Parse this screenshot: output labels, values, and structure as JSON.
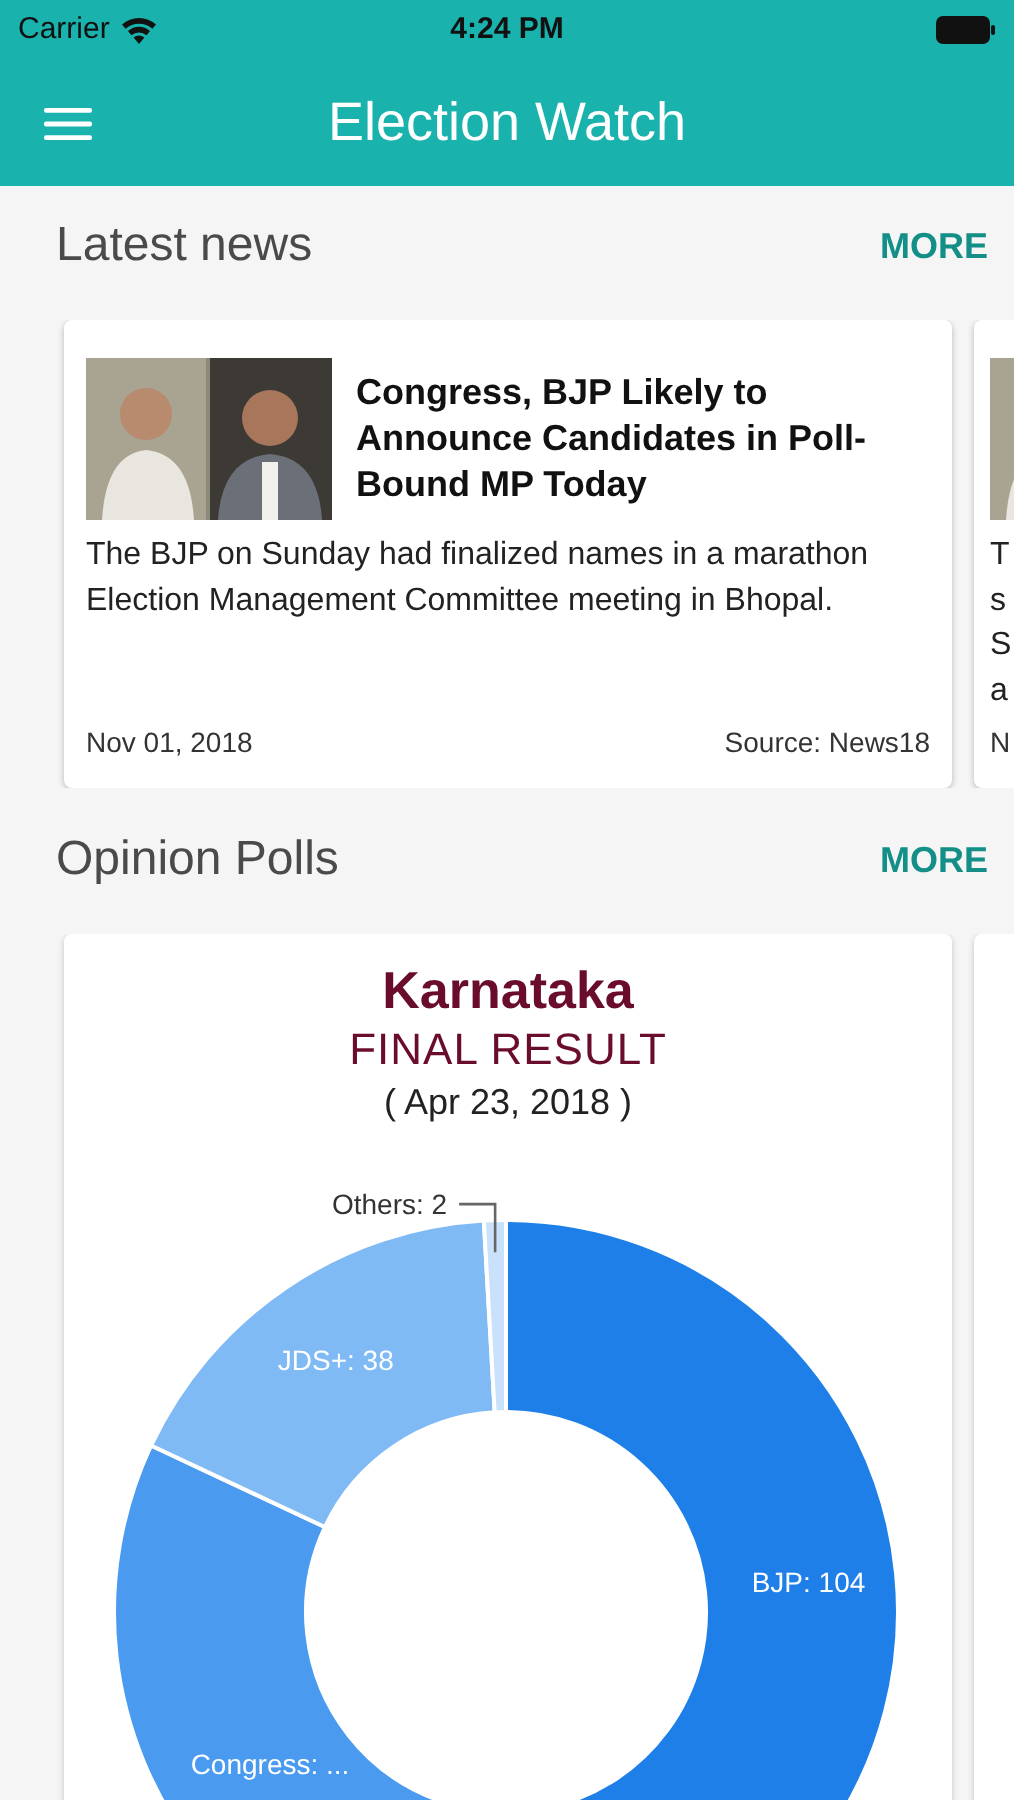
{
  "status_bar": {
    "carrier": "Carrier",
    "time": "4:24 PM"
  },
  "app_bar": {
    "title": "Election Watch"
  },
  "latest_news": {
    "heading": "Latest news",
    "more": "MORE",
    "items": [
      {
        "kind": "full",
        "title": "Congress, BJP Likely to Announce Candidates in Poll-Bound MP Today",
        "summary": "The BJP on Sunday had finalized names in a marathon Election Management Committee meeting in Bhopal.",
        "date": "Nov 01, 2018",
        "source": "Source: News18"
      },
      {
        "kind": "cut",
        "summary": "T\ns\nS\na",
        "date": "N"
      }
    ]
  },
  "opinion_polls": {
    "heading": "Opinion Polls",
    "more": "MORE",
    "cards": [
      {
        "kind": "chart",
        "title": "Karnataka",
        "subtitle": "FINAL RESULT",
        "date": "( Apr 23, 2018 )",
        "chart_data": {
          "type": "donut",
          "categories": [
            "BJP",
            "Congress",
            "JDS+",
            "Others"
          ],
          "values": [
            104,
            78,
            38,
            2
          ],
          "colors": [
            "#1e7fe8",
            "#4a9bef",
            "#7fbaf5",
            "#c9e1fb"
          ],
          "value_labels": [
            "104",
            "...",
            "38",
            "2"
          ]
        }
      },
      {
        "kind": "blank"
      }
    ]
  }
}
